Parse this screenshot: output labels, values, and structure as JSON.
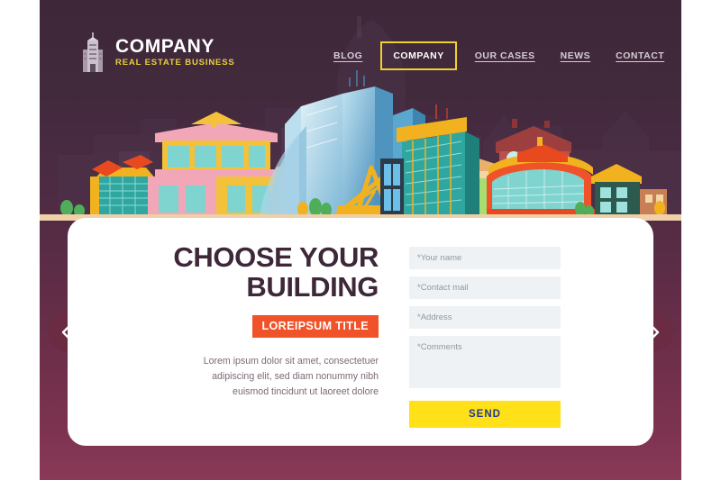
{
  "brand": {
    "logo_icon": "building-skyscraper-icon",
    "name": "COMPANY",
    "tagline": "REAL ESTATE BUSINESS"
  },
  "nav": {
    "items": [
      {
        "label": "BLOG",
        "active": false
      },
      {
        "label": "COMPANY",
        "active": true
      },
      {
        "label": "OUR CASES",
        "active": false
      },
      {
        "label": "NEWS",
        "active": false
      },
      {
        "label": "CONTACT",
        "active": false
      }
    ]
  },
  "hero": {
    "headline_line1": "CHOOSE YOUR",
    "headline_line2": "BUILDING",
    "badge": "LOREIPSUM TITLE",
    "body_line1": "Lorem ipsum dolor sit amet, consectetuer",
    "body_line2": "adipiscing elit, sed diam nonummy nibh",
    "body_line3": "euismod tincidunt ut laoreet dolore"
  },
  "form": {
    "name_placeholder": "*Your name",
    "mail_placeholder": "*Contact mail",
    "address_placeholder": "*Address",
    "comments_placeholder": "*Comments",
    "name_value": "",
    "mail_value": "",
    "address_value": "",
    "comments_value": "",
    "send_label": "SEND"
  },
  "carousel": {
    "prev_icon": "chevron-left-icon",
    "next_icon": "chevron-right-icon"
  },
  "colors": {
    "panel_top": "#3d2739",
    "panel_bottom": "#8a3a57",
    "accent_yellow": "#f0d12c",
    "badge_orange": "#f0522a",
    "button_yellow": "#ffe019",
    "button_text": "#1f3b8c",
    "field_bg": "#eef2f4",
    "arrow_bg": "#6b2b42",
    "ground": "#f0d0a8"
  }
}
